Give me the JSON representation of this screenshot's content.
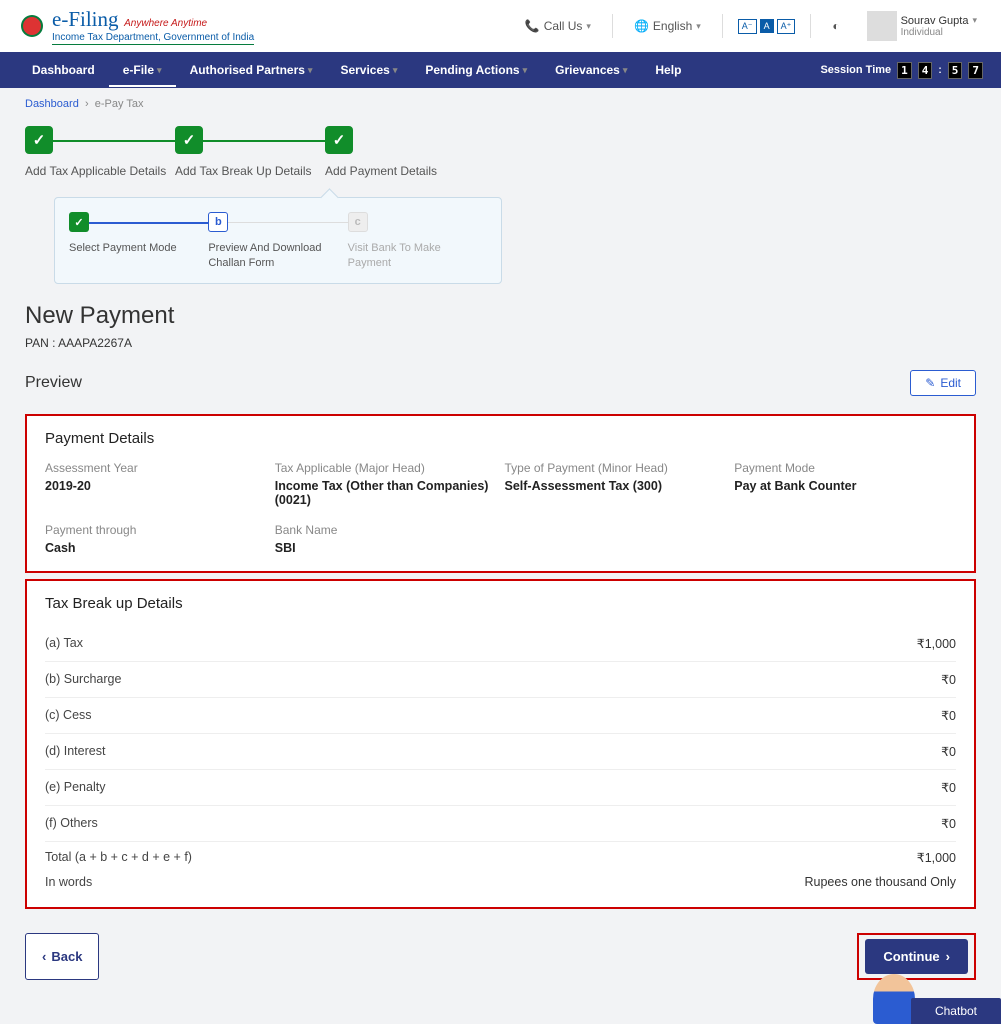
{
  "header": {
    "brand_title": "e-Filing",
    "brand_tag": "Anywhere Anytime",
    "brand_sub": "Income Tax Department, Government of India",
    "call_us": "Call Us",
    "language": "English",
    "user_name": "Sourav Gupta",
    "user_role": "Individual"
  },
  "nav": {
    "items": [
      "Dashboard",
      "e-File",
      "Authorised Partners",
      "Services",
      "Pending Actions",
      "Grievances",
      "Help"
    ],
    "session_label": "Session Time",
    "session_digits": [
      "1",
      "4",
      "5",
      "7"
    ]
  },
  "crumb": {
    "root": "Dashboard",
    "current": "e-Pay Tax"
  },
  "main_steps": [
    {
      "label": "Add Tax Applicable Details"
    },
    {
      "label": "Add Tax Break Up Details"
    },
    {
      "label": "Add Payment Details"
    }
  ],
  "sub_steps": [
    {
      "code": "",
      "label": "Select Payment Mode",
      "state": "done"
    },
    {
      "code": "b",
      "label": "Preview And Download Challan Form",
      "state": "active"
    },
    {
      "code": "c",
      "label": "Visit Bank To Make Payment",
      "state": "pending"
    }
  ],
  "page": {
    "title": "New Payment",
    "pan_label": "PAN :",
    "pan_value": "AAAPA2267A",
    "preview_label": "Preview",
    "edit_label": "Edit"
  },
  "details": {
    "heading": "Payment Details",
    "fields": [
      {
        "l": "Assessment Year",
        "v": "2019-20"
      },
      {
        "l": "Tax Applicable (Major Head)",
        "v": "Income Tax (Other than Companies) (0021)"
      },
      {
        "l": "Type of Payment (Minor Head)",
        "v": "Self-Assessment Tax (300)"
      },
      {
        "l": "Payment Mode",
        "v": "Pay at Bank Counter"
      },
      {
        "l": "Payment through",
        "v": "Cash"
      },
      {
        "l": "Bank Name",
        "v": "SBI"
      }
    ]
  },
  "breakup": {
    "heading": "Tax Break up Details",
    "rows": [
      {
        "l": "(a) Tax",
        "v": "1,000"
      },
      {
        "l": "(b) Surcharge",
        "v": "0"
      },
      {
        "l": "(c) Cess",
        "v": "0"
      },
      {
        "l": "(d) Interest",
        "v": "0"
      },
      {
        "l": "(e) Penalty",
        "v": "0"
      },
      {
        "l": "(f) Others",
        "v": "0"
      }
    ],
    "total_l": "Total (a + b + c + d + e + f)",
    "total_v": "1,000",
    "words_l": "In words",
    "words_v": "Rupees one thousand Only"
  },
  "actions": {
    "back": "Back",
    "continue": "Continue"
  },
  "chatbot": "Chatbot"
}
